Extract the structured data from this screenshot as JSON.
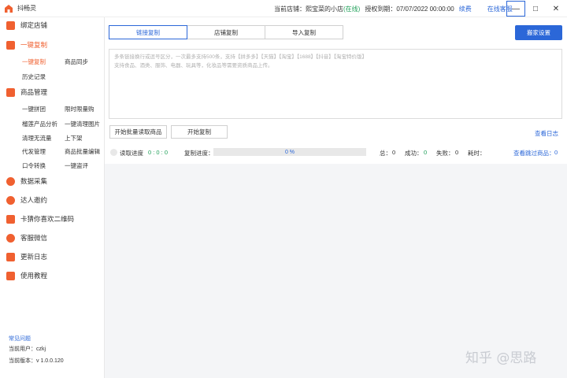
{
  "app": {
    "title": "抖畅灵"
  },
  "status": {
    "store_label": "当前店铺：",
    "store_name": "熙宝菜的小店",
    "online": "(在线)",
    "auth_label": "授权到期：",
    "auth_date": "07/07/2022 00:00:00",
    "renew": "续费",
    "service": "在线客服"
  },
  "window": {
    "minimize": "—",
    "maximize": "□",
    "close": "✕"
  },
  "sidebar": {
    "groups": [
      {
        "label": "绑定店铺",
        "icon": "store-icon",
        "color": "#f06030"
      },
      {
        "label": "一键复制",
        "icon": "copy-icon",
        "color": "#f06030",
        "active": true
      },
      {
        "label": "商品管理",
        "icon": "grid-icon",
        "color": "#f06030"
      },
      {
        "label": "数据采集",
        "icon": "collect-icon",
        "color": "#f06030"
      },
      {
        "label": "达人邀约",
        "icon": "invite-icon",
        "color": "#f06030"
      },
      {
        "label": "卡猜你喜欢二维码",
        "icon": "heart-icon",
        "color": "#f06030"
      },
      {
        "label": "客服微信",
        "icon": "wechat-icon",
        "color": "#f06030"
      },
      {
        "label": "更新日志",
        "icon": "log-icon",
        "color": "#f06030"
      },
      {
        "label": "使用教程",
        "icon": "book-icon",
        "color": "#f06030"
      }
    ],
    "copy_sub": [
      "一键复制",
      "商品同步",
      "历史记录"
    ],
    "manage_sub": [
      "一键拼团",
      "限时限量购",
      "榴莲产品分析",
      "一键清理图片",
      "清理无流量",
      "上下架",
      "代发管理",
      "商品批量编辑",
      "口令转换",
      "一键盗评"
    ],
    "footer": {
      "faq": "常见问题",
      "user": "当前用户：czkj",
      "version": "当前版本：v 1.0.0.120"
    }
  },
  "main": {
    "tabs": [
      "链接复制",
      "店铺复制",
      "导入复制"
    ],
    "settings_button": "搬家设置",
    "textarea_placeholder": "多条链接换行或逗号区分，一次最多支持500条，支持【拼多多】【天猫】【淘宝】【1688】【抖音】【淘宝特价版】\n支持食品、酒类、服饰、电器、玩具等，化妆品等需要资质商品上传。",
    "batch_button": "开始批量读取商品",
    "start_button": "开始复制",
    "view_log": "查看日志",
    "progress": {
      "read_label": "读取进度",
      "read_value": "0 : 0 : 0",
      "copy_label": "复制进度：",
      "percent": "0 %",
      "total_label": "总：",
      "total": "0",
      "success_label": "成功：",
      "success": "0",
      "fail_label": "失败：",
      "fail": "0",
      "time_label": "耗时：",
      "skipped_label": "查看跳过商品：",
      "skipped": "0"
    }
  },
  "watermark": "知乎 @思路"
}
